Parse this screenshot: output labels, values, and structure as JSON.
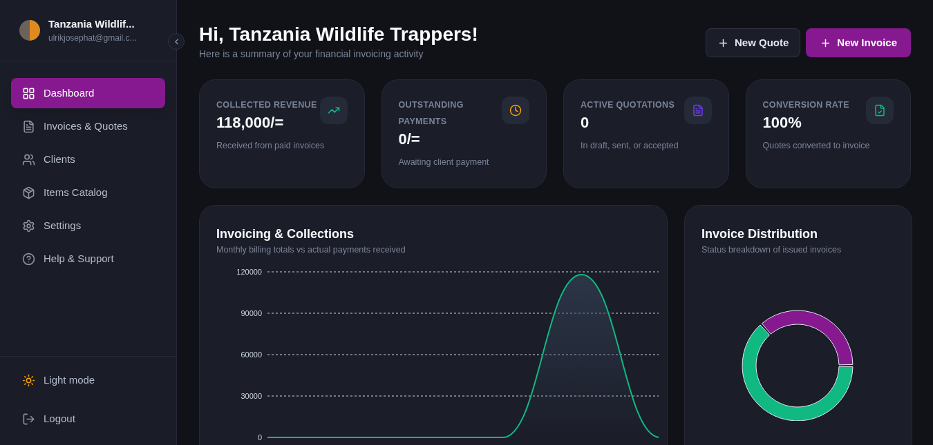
{
  "sidebar": {
    "org_name": "Tanzania Wildlif...",
    "email": "ulrikjosephat@gmail.c...",
    "items": [
      {
        "label": "Dashboard",
        "selected": true
      },
      {
        "label": "Invoices & Quotes",
        "selected": false
      },
      {
        "label": "Clients",
        "selected": false
      },
      {
        "label": "Items Catalog",
        "selected": false
      },
      {
        "label": "Settings",
        "selected": false
      },
      {
        "label": "Help & Support",
        "selected": false
      }
    ],
    "footer": [
      {
        "label": "Light mode"
      },
      {
        "label": "Logout"
      }
    ]
  },
  "header": {
    "title": "Hi, Tanzania Wildlife Trappers!",
    "subtitle": "Here is a summary of your financial invoicing activity",
    "buttons": [
      {
        "label": "New Quote",
        "kind": "secondary"
      },
      {
        "label": "New Invoice",
        "kind": "primary"
      }
    ]
  },
  "stats": [
    {
      "label": "COLLECTED REVENUE",
      "value": "118,000/=",
      "note": "Received from paid invoices",
      "color": "#10b981"
    },
    {
      "label": "OUTSTANDING PAYMENTS",
      "value": "0/=",
      "note": "Awaiting client payment",
      "color": "#f59e0b"
    },
    {
      "label": "ACTIVE QUOTATIONS",
      "value": "0",
      "note": "In draft, sent, or accepted",
      "color": "#6d3bf5"
    },
    {
      "label": "CONVERSION RATE",
      "value": "100%",
      "note": "Quotes converted to invoice",
      "color": "#10b981"
    }
  ],
  "collections_chart": {
    "title": "Invoicing & Collections",
    "subtitle": "Monthly billing totals vs actual payments received",
    "chart_data": {
      "type": "area",
      "grid": true,
      "ylim": [
        0,
        120000
      ],
      "yticks": [
        0,
        30000,
        60000,
        90000,
        120000
      ],
      "series": [
        {
          "color": "#10b981",
          "values": [
            0,
            0,
            0,
            0,
            118000,
            0
          ]
        }
      ]
    }
  },
  "distribution_chart": {
    "title": "Invoice Distribution",
    "subtitle": "Status breakdown of issued invoices"
  }
}
